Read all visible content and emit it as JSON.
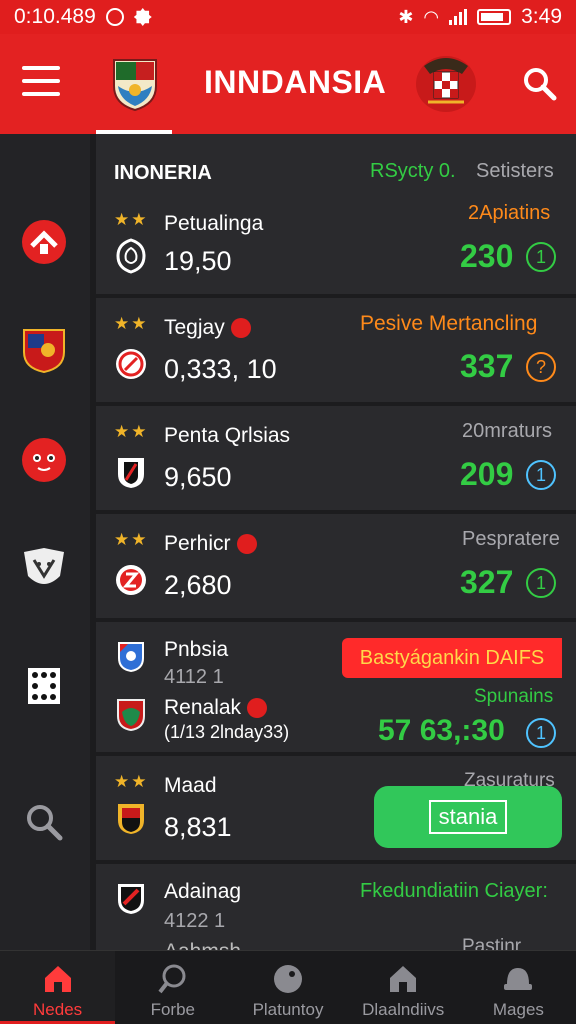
{
  "status_bar": {
    "time_left": "0:10.489",
    "time_right": "3:49"
  },
  "header": {
    "title": "INNDANSIA"
  },
  "colors": {
    "brand_red": "#e32222",
    "positive_green": "#33cc44",
    "warning_orange": "#ff8a1a",
    "star_gold": "#f0b429"
  },
  "sidebar": {
    "items": [
      {
        "icon": "home-badge-icon"
      },
      {
        "icon": "club-crest-icon"
      },
      {
        "icon": "face-icon"
      },
      {
        "icon": "wolf-crest-icon"
      },
      {
        "icon": "dice-icon"
      },
      {
        "icon": "search-icon"
      }
    ]
  },
  "list": {
    "section_title": "INONERIA",
    "section_link": "RSycty 0.",
    "section_aux": "Setisters",
    "cards": [
      {
        "stars": "★★",
        "name": "Petualinga",
        "value": "19,50",
        "tag": "2Apiatins",
        "score": "230",
        "badge": "1"
      },
      {
        "stars": "★★",
        "name": "Tegjay",
        "value": "0,333, 10",
        "tag": "Pesive Mertancling",
        "score": "337",
        "badge": "?"
      },
      {
        "stars": "★★",
        "name": "Penta Qrlsias",
        "value": "9,650",
        "tag": "20mraturs",
        "score": "209",
        "badge": "1"
      },
      {
        "stars": "★★",
        "name": "Perhicr",
        "value": "2,680",
        "tag": "Pespratere",
        "score": "327",
        "badge": "1"
      },
      {
        "name": "Pnbsia",
        "value": "4112 1",
        "name2": "Renalak",
        "sub2": "(1/13 2lnday33)",
        "promo": "Bastyágankin DAIFS",
        "tag": "Spunains",
        "score": "57 63,:30",
        "badge": "1"
      },
      {
        "stars": "★★",
        "name": "Maad",
        "value": "8,831",
        "tag": "Zasuraturs",
        "cta": "stania"
      },
      {
        "name": "Adainag",
        "value": "4122 1",
        "tag": "Fkedundiatiin Ciayer:",
        "name2": "Aahmsh",
        "tag2": "Pastinr"
      }
    ]
  },
  "bottom_nav": {
    "items": [
      {
        "label": "Nedes",
        "icon": "home-icon",
        "active": true
      },
      {
        "label": "Forbe",
        "icon": "magnifier-icon",
        "active": false
      },
      {
        "label": "Platuntoy",
        "icon": "ball-icon",
        "active": false
      },
      {
        "label": "Dlaalndiivs",
        "icon": "house-icon",
        "active": false
      },
      {
        "label": "Mages",
        "icon": "hat-icon",
        "active": false
      }
    ]
  }
}
